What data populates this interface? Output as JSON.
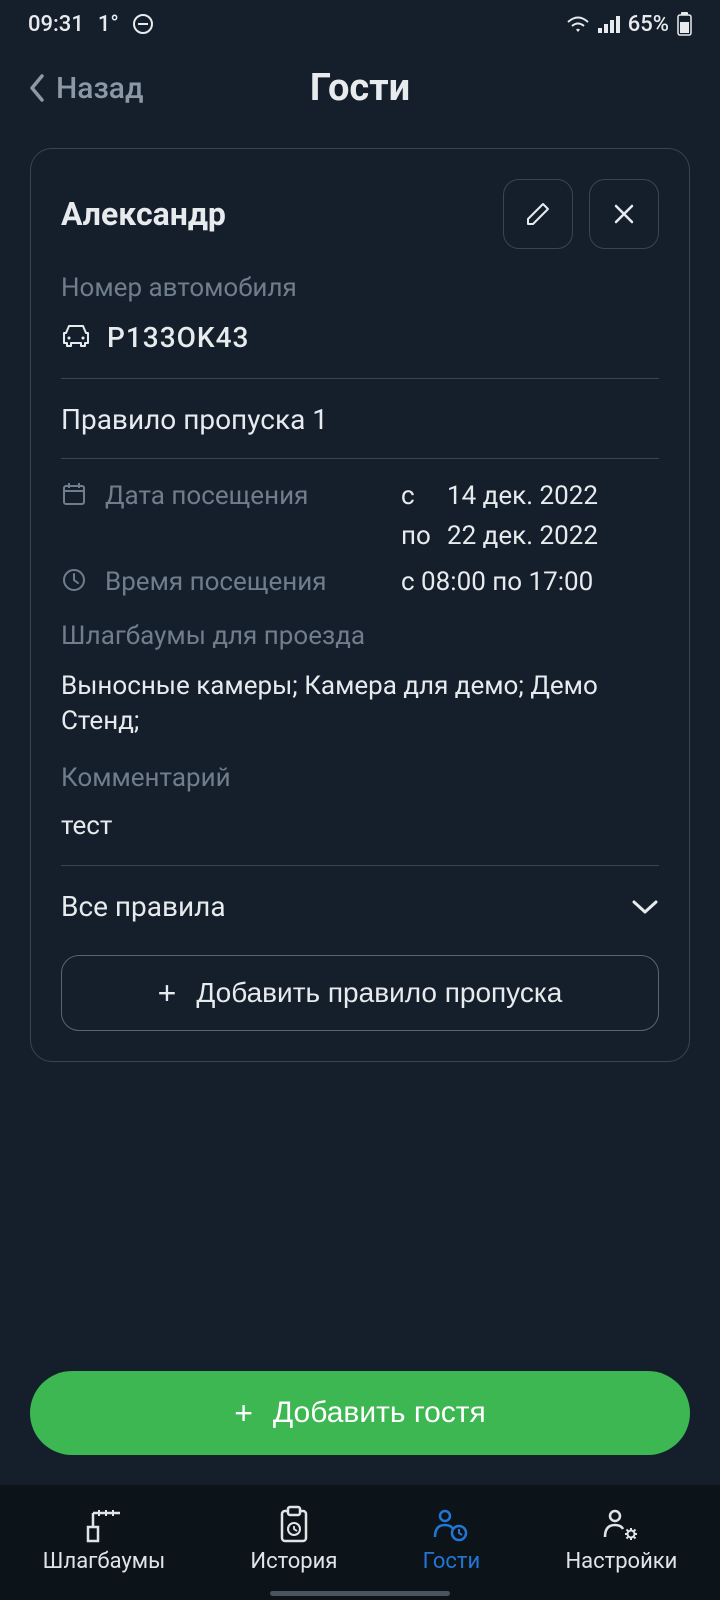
{
  "status": {
    "time": "09:31",
    "temp": "1°",
    "battery": "65%"
  },
  "header": {
    "back": "Назад",
    "title": "Гости"
  },
  "card": {
    "name": "Александр",
    "plate_label": "Номер автомобиля",
    "plate_value": "P133OK43",
    "rule_title": "Правило пропуска 1",
    "date_label": "Дата посещения",
    "date_from_prefix": "с",
    "date_from": "14 дек. 2022",
    "date_to_prefix": "по",
    "date_to": "22 дек. 2022",
    "time_label": "Время посещения",
    "time_value": "с 08:00 по 17:00",
    "barriers_label": "Шлагбаумы для проезда",
    "barriers_value": "Выносные камеры; Камера для демо; Демо Стенд;",
    "comment_label": "Комментарий",
    "comment_value": "тест",
    "all_rules": "Все правила",
    "add_rule": "Добавить правило пропуска"
  },
  "add_guest": "Добавить гостя",
  "nav": {
    "barriers": "Шлагбаумы",
    "history": "История",
    "guests": "Гости",
    "settings": "Настройки"
  }
}
